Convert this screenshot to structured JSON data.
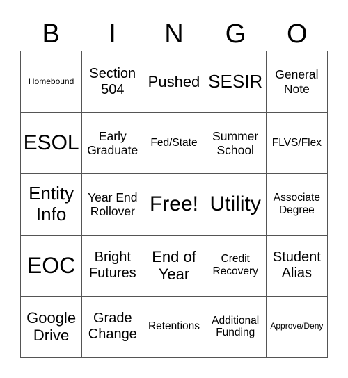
{
  "header": [
    "B",
    "I",
    "N",
    "G",
    "O"
  ],
  "cells": [
    [
      "Homebound",
      "Section 504",
      "Pushed",
      "SESIR",
      "General Note"
    ],
    [
      "ESOL",
      "Early Graduate",
      "Fed/State",
      "Summer School",
      "FLVS/Flex"
    ],
    [
      "Entity Info",
      "Year End Rollover",
      "Free!",
      "Utility",
      "Associate Degree"
    ],
    [
      "EOC",
      "Bright Futures",
      "End of Year",
      "Credit Recovery",
      "Student Alias"
    ],
    [
      "Google Drive",
      "Grade Change",
      "Retentions",
      "Additional Funding",
      "Approve/Deny"
    ]
  ]
}
